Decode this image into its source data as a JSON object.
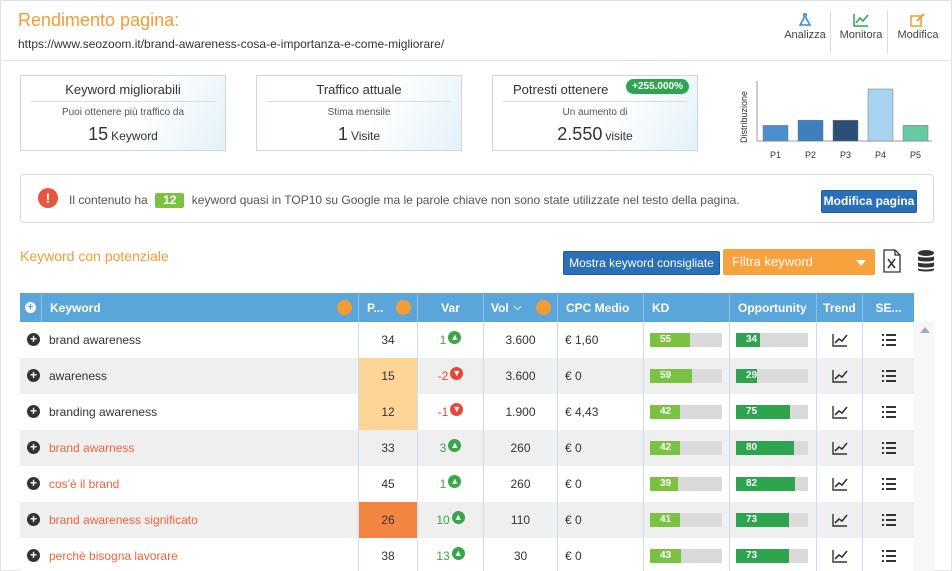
{
  "header": {
    "title": "Rendimento pagina:",
    "url": "https://www.seozoom.it/brand-awareness-cosa-e-importanza-e-come-migliorare/",
    "actions": [
      {
        "label": "Analizza",
        "icon": "flask-icon"
      },
      {
        "label": "Monitora",
        "icon": "chart-line-icon"
      },
      {
        "label": "Modifica",
        "icon": "edit-icon"
      }
    ]
  },
  "cards": [
    {
      "title": "Keyword migliorabili",
      "subtitle": "Puoi ottenere più traffico da",
      "value": "15",
      "unit": "Keyword"
    },
    {
      "title": "Traffico attuale",
      "subtitle": "Stima mensile",
      "value": "1",
      "unit": "Visite"
    },
    {
      "title": "Potresti ottenere",
      "subtitle": "Un aumento di",
      "value": "2.550",
      "unit": "visite",
      "badge": "+255.000%"
    }
  ],
  "chart_data": {
    "type": "bar",
    "ylabel": "Distribuzione",
    "categories": [
      "P1",
      "P2",
      "P3",
      "P4",
      "P5"
    ],
    "values": [
      3,
      4,
      4,
      10,
      3
    ],
    "colors": [
      "#4a90d0",
      "#3f7fbf",
      "#2d4e78",
      "#a8d3ee",
      "#66cba4"
    ]
  },
  "info": {
    "text_before": "Il contenuto ha",
    "count": "12",
    "text_after": "keyword quasi in TOP10 su Google ma le parole chiave non sono state utilizzate nel testo della pagina.",
    "button": "Modifica pagina"
  },
  "section": {
    "title": "Keyword con potenziale",
    "show_button": "Mostra keyword consigliate",
    "filter_label": "Filtra keyword"
  },
  "table": {
    "headers": [
      "Keyword",
      "P...",
      "Var",
      "Vol",
      "CPC Medio",
      "KD",
      "Opportunity",
      "Trend",
      "SE..."
    ],
    "rows": [
      {
        "keyword": "brand awareness",
        "pos": "34",
        "var": "1",
        "dir": "up",
        "vol": "3.600",
        "cpc": "€ 1,60",
        "kd": 55,
        "opp": 34,
        "link": false,
        "hl": ""
      },
      {
        "keyword": "awareness",
        "pos": "15",
        "var": "-2",
        "dir": "down",
        "vol": "3.600",
        "cpc": "€ 0",
        "kd": 59,
        "opp": 29,
        "link": false,
        "hl": "light"
      },
      {
        "keyword": "branding awareness",
        "pos": "12",
        "var": "-1",
        "dir": "down",
        "vol": "1.900",
        "cpc": "€ 4,43",
        "kd": 42,
        "opp": 75,
        "link": false,
        "hl": "light"
      },
      {
        "keyword": "brand awarness",
        "pos": "33",
        "var": "3",
        "dir": "up",
        "vol": "260",
        "cpc": "€ 0",
        "kd": 42,
        "opp": 80,
        "link": true,
        "hl": ""
      },
      {
        "keyword": "cos'è il brand",
        "pos": "45",
        "var": "1",
        "dir": "up",
        "vol": "260",
        "cpc": "€ 0",
        "kd": 39,
        "opp": 82,
        "link": true,
        "hl": ""
      },
      {
        "keyword": "brand awareness significato",
        "pos": "26",
        "var": "10",
        "dir": "up",
        "vol": "110",
        "cpc": "€ 0",
        "kd": 41,
        "opp": 73,
        "link": true,
        "hl": "dark"
      },
      {
        "keyword": "perchè bisogna lavorare",
        "pos": "38",
        "var": "13",
        "dir": "up",
        "vol": "30",
        "cpc": "€ 0",
        "kd": 43,
        "opp": 73,
        "link": true,
        "hl": ""
      }
    ]
  },
  "colors": {
    "accent_orange": "#f39c34",
    "header_blue": "#5aa5d9",
    "button_blue": "#2a6fb8",
    "kd_green": "#7cc242",
    "opp_green": "#2ea44f"
  }
}
